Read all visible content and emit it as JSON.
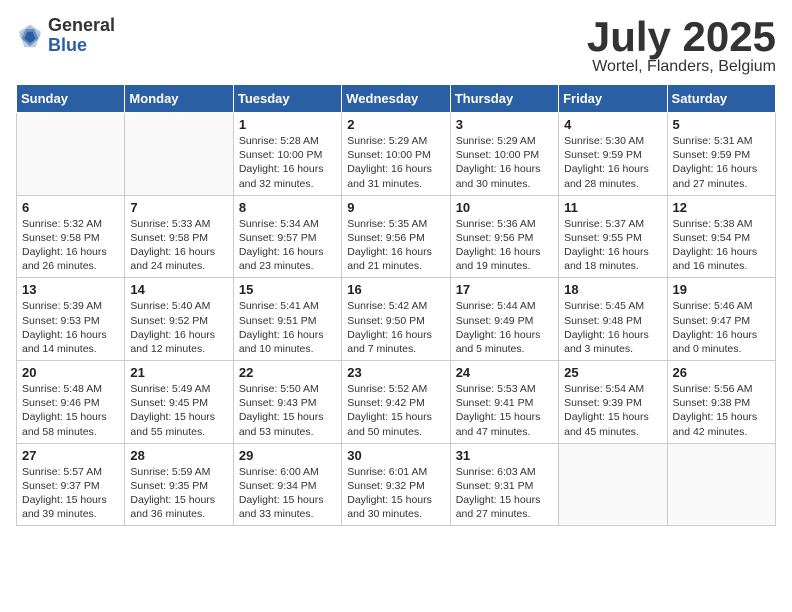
{
  "logo": {
    "general": "General",
    "blue": "Blue"
  },
  "title": "July 2025",
  "location": "Wortel, Flanders, Belgium",
  "weekdays": [
    "Sunday",
    "Monday",
    "Tuesday",
    "Wednesday",
    "Thursday",
    "Friday",
    "Saturday"
  ],
  "weeks": [
    [
      {
        "day": null,
        "info": null
      },
      {
        "day": null,
        "info": null
      },
      {
        "day": "1",
        "info": "Sunrise: 5:28 AM\nSunset: 10:00 PM\nDaylight: 16 hours\nand 32 minutes."
      },
      {
        "day": "2",
        "info": "Sunrise: 5:29 AM\nSunset: 10:00 PM\nDaylight: 16 hours\nand 31 minutes."
      },
      {
        "day": "3",
        "info": "Sunrise: 5:29 AM\nSunset: 10:00 PM\nDaylight: 16 hours\nand 30 minutes."
      },
      {
        "day": "4",
        "info": "Sunrise: 5:30 AM\nSunset: 9:59 PM\nDaylight: 16 hours\nand 28 minutes."
      },
      {
        "day": "5",
        "info": "Sunrise: 5:31 AM\nSunset: 9:59 PM\nDaylight: 16 hours\nand 27 minutes."
      }
    ],
    [
      {
        "day": "6",
        "info": "Sunrise: 5:32 AM\nSunset: 9:58 PM\nDaylight: 16 hours\nand 26 minutes."
      },
      {
        "day": "7",
        "info": "Sunrise: 5:33 AM\nSunset: 9:58 PM\nDaylight: 16 hours\nand 24 minutes."
      },
      {
        "day": "8",
        "info": "Sunrise: 5:34 AM\nSunset: 9:57 PM\nDaylight: 16 hours\nand 23 minutes."
      },
      {
        "day": "9",
        "info": "Sunrise: 5:35 AM\nSunset: 9:56 PM\nDaylight: 16 hours\nand 21 minutes."
      },
      {
        "day": "10",
        "info": "Sunrise: 5:36 AM\nSunset: 9:56 PM\nDaylight: 16 hours\nand 19 minutes."
      },
      {
        "day": "11",
        "info": "Sunrise: 5:37 AM\nSunset: 9:55 PM\nDaylight: 16 hours\nand 18 minutes."
      },
      {
        "day": "12",
        "info": "Sunrise: 5:38 AM\nSunset: 9:54 PM\nDaylight: 16 hours\nand 16 minutes."
      }
    ],
    [
      {
        "day": "13",
        "info": "Sunrise: 5:39 AM\nSunset: 9:53 PM\nDaylight: 16 hours\nand 14 minutes."
      },
      {
        "day": "14",
        "info": "Sunrise: 5:40 AM\nSunset: 9:52 PM\nDaylight: 16 hours\nand 12 minutes."
      },
      {
        "day": "15",
        "info": "Sunrise: 5:41 AM\nSunset: 9:51 PM\nDaylight: 16 hours\nand 10 minutes."
      },
      {
        "day": "16",
        "info": "Sunrise: 5:42 AM\nSunset: 9:50 PM\nDaylight: 16 hours\nand 7 minutes."
      },
      {
        "day": "17",
        "info": "Sunrise: 5:44 AM\nSunset: 9:49 PM\nDaylight: 16 hours\nand 5 minutes."
      },
      {
        "day": "18",
        "info": "Sunrise: 5:45 AM\nSunset: 9:48 PM\nDaylight: 16 hours\nand 3 minutes."
      },
      {
        "day": "19",
        "info": "Sunrise: 5:46 AM\nSunset: 9:47 PM\nDaylight: 16 hours\nand 0 minutes."
      }
    ],
    [
      {
        "day": "20",
        "info": "Sunrise: 5:48 AM\nSunset: 9:46 PM\nDaylight: 15 hours\nand 58 minutes."
      },
      {
        "day": "21",
        "info": "Sunrise: 5:49 AM\nSunset: 9:45 PM\nDaylight: 15 hours\nand 55 minutes."
      },
      {
        "day": "22",
        "info": "Sunrise: 5:50 AM\nSunset: 9:43 PM\nDaylight: 15 hours\nand 53 minutes."
      },
      {
        "day": "23",
        "info": "Sunrise: 5:52 AM\nSunset: 9:42 PM\nDaylight: 15 hours\nand 50 minutes."
      },
      {
        "day": "24",
        "info": "Sunrise: 5:53 AM\nSunset: 9:41 PM\nDaylight: 15 hours\nand 47 minutes."
      },
      {
        "day": "25",
        "info": "Sunrise: 5:54 AM\nSunset: 9:39 PM\nDaylight: 15 hours\nand 45 minutes."
      },
      {
        "day": "26",
        "info": "Sunrise: 5:56 AM\nSunset: 9:38 PM\nDaylight: 15 hours\nand 42 minutes."
      }
    ],
    [
      {
        "day": "27",
        "info": "Sunrise: 5:57 AM\nSunset: 9:37 PM\nDaylight: 15 hours\nand 39 minutes."
      },
      {
        "day": "28",
        "info": "Sunrise: 5:59 AM\nSunset: 9:35 PM\nDaylight: 15 hours\nand 36 minutes."
      },
      {
        "day": "29",
        "info": "Sunrise: 6:00 AM\nSunset: 9:34 PM\nDaylight: 15 hours\nand 33 minutes."
      },
      {
        "day": "30",
        "info": "Sunrise: 6:01 AM\nSunset: 9:32 PM\nDaylight: 15 hours\nand 30 minutes."
      },
      {
        "day": "31",
        "info": "Sunrise: 6:03 AM\nSunset: 9:31 PM\nDaylight: 15 hours\nand 27 minutes."
      },
      {
        "day": null,
        "info": null
      },
      {
        "day": null,
        "info": null
      }
    ]
  ]
}
